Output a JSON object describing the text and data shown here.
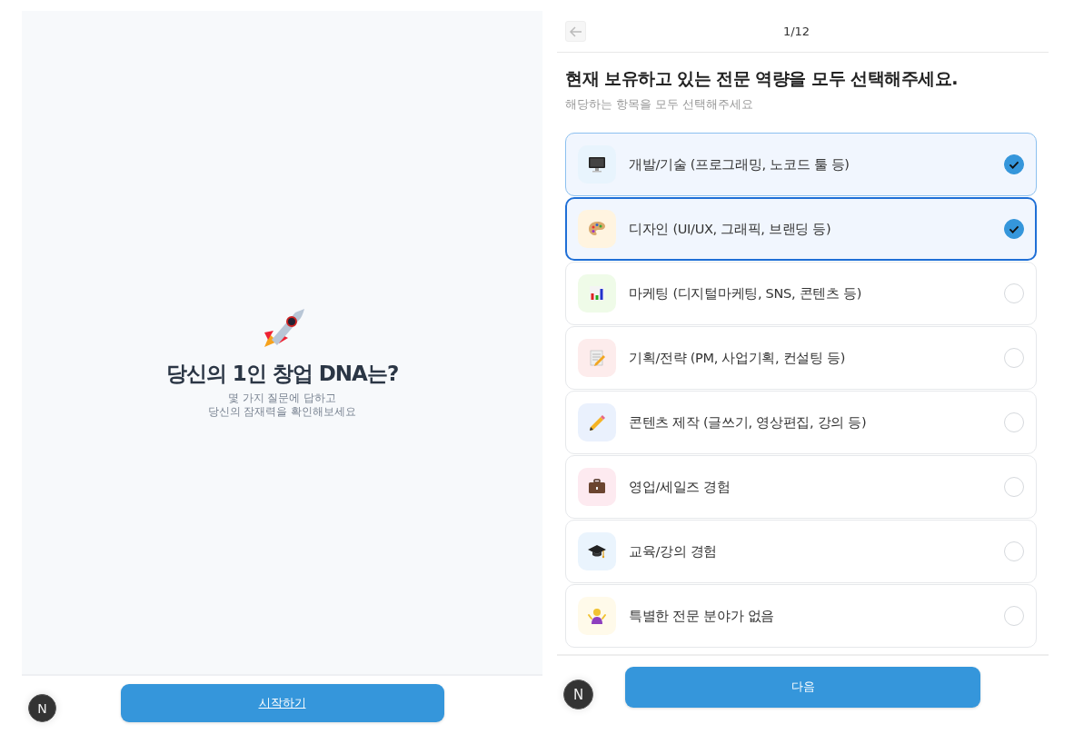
{
  "intro": {
    "title": "당신의 1인 창업 DNA는?",
    "subtitle_lines": [
      "몇 가지 질문에 답하고",
      "당신의 잠재력을 확인해보세요"
    ],
    "start_button": "시작하기",
    "badge": "N"
  },
  "quiz": {
    "progress": "1/12",
    "question": "현재 보유하고 있는 전문 역량을 모두 선택해주세요.",
    "hint": "해당하는 항목을 모두 선택해주세요",
    "options": [
      {
        "label": "개발/기술 (프로그래밍, 노코드 툴 등)",
        "selected": true,
        "focused": false
      },
      {
        "label": "디자인 (UI/UX, 그래픽, 브랜딩 등)",
        "selected": true,
        "focused": true
      },
      {
        "label": "마케팅 (디지털마케팅, SNS, 콘텐츠 등)",
        "selected": false,
        "focused": false
      },
      {
        "label": "기획/전략 (PM, 사업기획, 컨설팅 등)",
        "selected": false,
        "focused": false
      },
      {
        "label": "콘텐츠 제작 (글쓰기, 영상편집, 강의 등)",
        "selected": false,
        "focused": false
      },
      {
        "label": "영업/세일즈 경험",
        "selected": false,
        "focused": false
      },
      {
        "label": "교육/강의 경험",
        "selected": false,
        "focused": false
      },
      {
        "label": "특별한 전문 분야가 없음",
        "selected": false,
        "focused": false
      }
    ],
    "next_button": "다음",
    "badge": "N"
  }
}
